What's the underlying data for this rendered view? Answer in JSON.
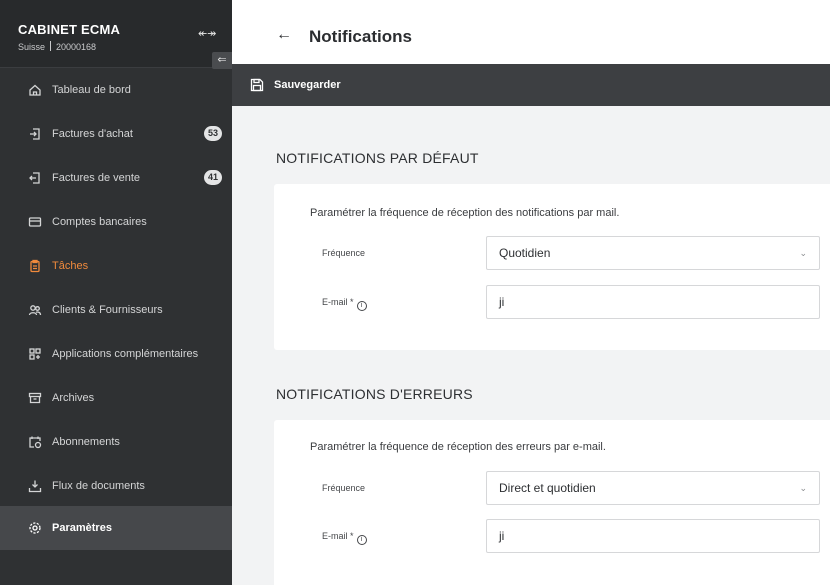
{
  "sidebar": {
    "company": "CABINET ECMA",
    "country": "Suisse",
    "account_id": "20000168",
    "items": [
      {
        "label": "Tableau de bord",
        "badge": ""
      },
      {
        "label": "Factures d'achat",
        "badge": "53"
      },
      {
        "label": "Factures de vente",
        "badge": "41"
      },
      {
        "label": "Comptes bancaires",
        "badge": ""
      },
      {
        "label": "Tâches",
        "badge": ""
      },
      {
        "label": "Clients & Fournisseurs",
        "badge": ""
      },
      {
        "label": "Applications complémentaires",
        "badge": ""
      },
      {
        "label": "Archives",
        "badge": ""
      },
      {
        "label": "Abonnements",
        "badge": ""
      },
      {
        "label": "Flux de documents",
        "badge": ""
      },
      {
        "label": "Paramètres",
        "badge": ""
      }
    ],
    "highlight_color": "#f08a3c",
    "background": "#2f3133"
  },
  "header": {
    "title": "Notifications"
  },
  "toolbar": {
    "save_label": "Sauvegarder"
  },
  "sections": [
    {
      "title": "NOTIFICATIONS PAR DÉFAUT",
      "description": "Paramétrer la fréquence de réception des notifications par mail.",
      "frequency_label": "Fréquence",
      "frequency_value": "Quotidien",
      "email_label": "E-mail *",
      "email_value": "ji"
    },
    {
      "title": "NOTIFICATIONS D'ERREURS",
      "description": "Paramétrer la fréquence de réception des erreurs par e-mail.",
      "frequency_label": "Fréquence",
      "frequency_value": "Direct et quotidien",
      "email_label": "E-mail *",
      "email_value": "ji"
    }
  ]
}
